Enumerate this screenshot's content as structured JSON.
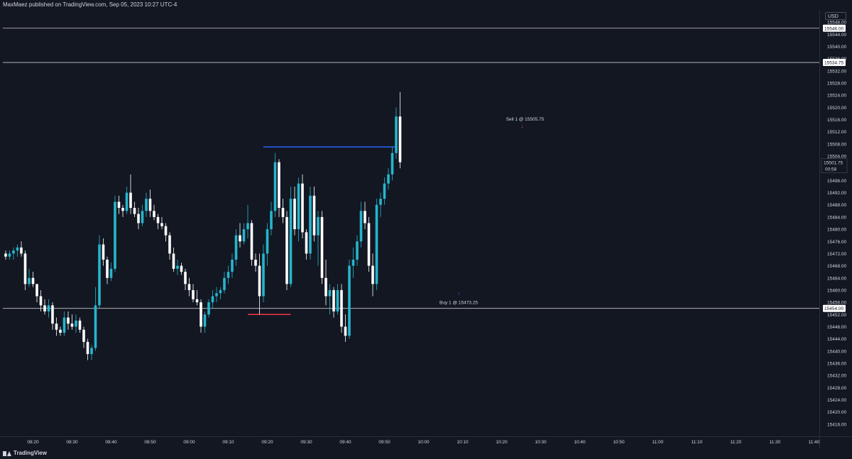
{
  "header": {
    "publisher_text": "MaxMaez published on TradingView.com, Sep 05, 2023 10:27 UTC-4"
  },
  "price_scale": {
    "currency": "USD",
    "price_labels": [
      "15548.00",
      "15544.00",
      "15540.00",
      "15536.00",
      "15532.00",
      "15528.00",
      "15524.00",
      "15520.00",
      "15516.00",
      "15512.00",
      "15508.00",
      "15504.00",
      "15496.00",
      "15492.00",
      "15488.00",
      "15484.00",
      "15480.00",
      "15476.00",
      "15472.00",
      "15468.00",
      "15464.00",
      "15460.00",
      "15456.00",
      "15452.00",
      "15448.00",
      "15444.00",
      "15440.00",
      "15436.00",
      "15432.00",
      "15428.00",
      "15424.00",
      "15420.00",
      "15416.00"
    ],
    "last_price": "15501.75",
    "countdown": "00:58"
  },
  "time_axis": {
    "labels": [
      "08:20",
      "08:30",
      "08:40",
      "08:50",
      "09:00",
      "09:10",
      "09:20",
      "09:30",
      "09:40",
      "09:50",
      "10:00",
      "10:10",
      "10:20",
      "10:30",
      "10:40",
      "10:50",
      "11:00",
      "11:10",
      "11:20",
      "11:30",
      "11:40"
    ]
  },
  "annotations": {
    "sell_label": "Sell 1 @ 15505.75",
    "buy_label": "Buy 1 @ 15473.25",
    "hline_labels": [
      "15546.00",
      "15534.75",
      "15454.00"
    ]
  },
  "footer": {
    "brand": "TradingView"
  },
  "colors": {
    "background": "#131722",
    "bull": "#26b5cc",
    "bear": "#ffffff",
    "text": "#d1d4dc",
    "blue_line": "#2962ff",
    "red_line": "#f23645",
    "hline": "#c8c8c8"
  },
  "chart_data": {
    "type": "candlestick",
    "timeframe": "1 minute",
    "x_start": "08:13",
    "y_range": [
      15412,
      15552
    ],
    "candles": [
      [
        15472,
        15473,
        15470,
        15471
      ],
      [
        15471,
        15473,
        15470,
        15472
      ],
      [
        15472,
        15474,
        15470,
        15473
      ],
      [
        15473,
        15475,
        15471,
        15474
      ],
      [
        15474,
        15476,
        15471,
        15472
      ],
      [
        15472,
        15473,
        15460,
        15462
      ],
      [
        15462,
        15467,
        15461,
        15464
      ],
      [
        15464,
        15466,
        15461,
        15462
      ],
      [
        15462,
        15462,
        15456,
        15458
      ],
      [
        15458,
        15460,
        15453,
        15455
      ],
      [
        15455,
        15457,
        15452,
        15453
      ],
      [
        15453,
        15457,
        15451,
        15455
      ],
      [
        15455,
        15456,
        15447,
        15449
      ],
      [
        15449,
        15451,
        15445,
        15447
      ],
      [
        15447,
        15448,
        15445,
        15446
      ],
      [
        15446,
        15453,
        15445,
        15451
      ],
      [
        15451,
        15453,
        15447,
        15449
      ],
      [
        15449,
        15452,
        15447,
        15448
      ],
      [
        15448,
        15452,
        15446,
        15450
      ],
      [
        15450,
        15451,
        15446,
        15447
      ],
      [
        15447,
        15448,
        15441,
        15443
      ],
      [
        15443,
        15444,
        15437,
        15439
      ],
      [
        15439,
        15442,
        15437,
        15441
      ],
      [
        15441,
        15461,
        15440,
        15455
      ],
      [
        15455,
        15478,
        15454,
        15475
      ],
      [
        15475,
        15477,
        15468,
        15470
      ],
      [
        15470,
        15471,
        15462,
        15464
      ],
      [
        15464,
        15469,
        15463,
        15467
      ],
      [
        15467,
        15491,
        15466,
        15489
      ],
      [
        15489,
        15491,
        15485,
        15487
      ],
      [
        15487,
        15488,
        15484,
        15486
      ],
      [
        15486,
        15494,
        15485,
        15492
      ],
      [
        15492,
        15498,
        15485,
        15487
      ],
      [
        15487,
        15489,
        15484,
        15485
      ],
      [
        15485,
        15487,
        15480,
        15482
      ],
      [
        15482,
        15488,
        15481,
        15486
      ],
      [
        15486,
        15492,
        15484,
        15490
      ],
      [
        15490,
        15493,
        15484,
        15486
      ],
      [
        15486,
        15488,
        15483,
        15484
      ],
      [
        15484,
        15485,
        15480,
        15482
      ],
      [
        15482,
        15484,
        15480,
        15481
      ],
      [
        15481,
        15482,
        15476,
        15478
      ],
      [
        15478,
        15479,
        15470,
        15472
      ],
      [
        15472,
        15474,
        15466,
        15467
      ],
      [
        15467,
        15470,
        15465,
        15468
      ],
      [
        15468,
        15469,
        15465,
        15466
      ],
      [
        15466,
        15467,
        15460,
        15462
      ],
      [
        15462,
        15464,
        15458,
        15460
      ],
      [
        15460,
        15462,
        15456,
        15457
      ],
      [
        15457,
        15460,
        15455,
        15456
      ],
      [
        15456,
        15457,
        15446,
        15448
      ],
      [
        15448,
        15453,
        15446,
        15452
      ],
      [
        15452,
        15457,
        15451,
        15456
      ],
      [
        15456,
        15460,
        15454,
        15458
      ],
      [
        15458,
        15461,
        15456,
        15459
      ],
      [
        15459,
        15461,
        15457,
        15460
      ],
      [
        15460,
        15466,
        15459,
        15464
      ],
      [
        15464,
        15468,
        15462,
        15466
      ],
      [
        15466,
        15472,
        15464,
        15470
      ],
      [
        15470,
        15480,
        15468,
        15478
      ],
      [
        15478,
        15482,
        15474,
        15476
      ],
      [
        15476,
        15482,
        15475,
        15480
      ],
      [
        15480,
        15488,
        15477,
        15482
      ],
      [
        15482,
        15483,
        15468,
        15470
      ],
      [
        15470,
        15472,
        15466,
        15468
      ],
      [
        15468,
        15472,
        15452,
        15458
      ],
      [
        15458,
        15475,
        15456,
        15472
      ],
      [
        15472,
        15482,
        15468,
        15480
      ],
      [
        15480,
        15489,
        15478,
        15486
      ],
      [
        15486,
        15505,
        15484,
        15502
      ],
      [
        15502,
        15503,
        15484,
        15487
      ],
      [
        15487,
        15490,
        15482,
        15484
      ],
      [
        15484,
        15486,
        15460,
        15462
      ],
      [
        15462,
        15494,
        15461,
        15490
      ],
      [
        15490,
        15494,
        15478,
        15480
      ],
      [
        15480,
        15497,
        15476,
        15495
      ],
      [
        15495,
        15498,
        15477,
        15479
      ],
      [
        15479,
        15480,
        15470,
        15472
      ],
      [
        15472,
        15494,
        15470,
        15491
      ],
      [
        15491,
        15494,
        15476,
        15478
      ],
      [
        15478,
        15486,
        15468,
        15484
      ],
      [
        15484,
        15486,
        15462,
        15464
      ],
      [
        15464,
        15470,
        15455,
        15458
      ],
      [
        15458,
        15462,
        15452,
        15460
      ],
      [
        15460,
        15461,
        15451,
        15453
      ],
      [
        15453,
        15462,
        15452,
        15460
      ],
      [
        15460,
        15462,
        15446,
        15448
      ],
      [
        15448,
        15452,
        15443,
        15445
      ],
      [
        15445,
        15470,
        15444,
        15468
      ],
      [
        15468,
        15474,
        15464,
        15470
      ],
      [
        15470,
        15478,
        15468,
        15476
      ],
      [
        15476,
        15489,
        15474,
        15486
      ],
      [
        15486,
        15489,
        15480,
        15482
      ],
      [
        15482,
        15484,
        15466,
        15468
      ],
      [
        15468,
        15472,
        15458,
        15462
      ],
      [
        15462,
        15490,
        15460,
        15488
      ],
      [
        15488,
        15492,
        15484,
        15490
      ],
      [
        15490,
        15497,
        15488,
        15495
      ],
      [
        15495,
        15500,
        15493,
        15498
      ],
      [
        15498,
        15507,
        15496,
        15505
      ],
      [
        15505,
        15520,
        15503,
        15517
      ],
      [
        15517,
        15525,
        15500,
        15502
      ]
    ],
    "horizontal_levels": [
      15546.0,
      15534.75,
      15454.0
    ],
    "segments": [
      {
        "color": "blue",
        "from_candle": 66,
        "to_candle": 100,
        "price": 15507
      },
      {
        "color": "red",
        "from_candle": 62,
        "to_candle": 73,
        "price": 15452
      }
    ],
    "trades": [
      {
        "side": "sell",
        "price": 15505.75,
        "time": "10:26"
      },
      {
        "side": "buy",
        "price": 15473.25,
        "time": "10:09"
      }
    ],
    "last_price": 15501.75
  }
}
